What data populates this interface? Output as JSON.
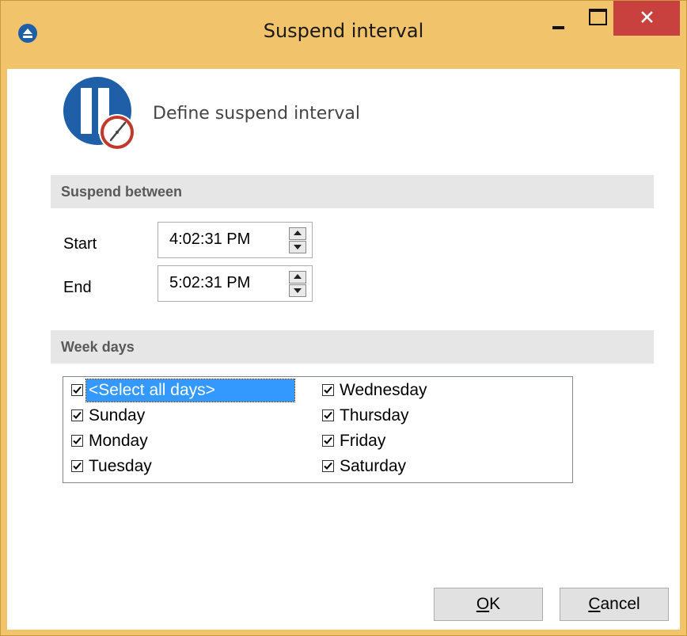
{
  "window": {
    "title": "Suspend interval",
    "icons": {
      "app": "eject-icon",
      "minimize": "minimize-icon",
      "maximize": "maximize-icon",
      "close": "close-icon"
    }
  },
  "header": {
    "icon": "pause-clock-icon",
    "subtitle": "Define suspend interval"
  },
  "suspend_between": {
    "title": "Suspend between",
    "start": {
      "label": "Start",
      "value": "4:02:31 PM"
    },
    "end": {
      "label": "End",
      "value": "5:02:31 PM"
    }
  },
  "week_days": {
    "title": "Week days",
    "items": [
      {
        "label": "<Select all days>",
        "checked": true,
        "selected": true
      },
      {
        "label": "Sunday",
        "checked": true
      },
      {
        "label": "Monday",
        "checked": true
      },
      {
        "label": "Tuesday",
        "checked": true
      },
      {
        "label": "Wednesday",
        "checked": true
      },
      {
        "label": "Thursday",
        "checked": true
      },
      {
        "label": "Friday",
        "checked": true
      },
      {
        "label": "Saturday",
        "checked": true
      }
    ]
  },
  "buttons": {
    "ok": {
      "accel": "O",
      "rest": "K"
    },
    "cancel": {
      "accel": "C",
      "rest": "ancel"
    }
  },
  "colors": {
    "frame": "#f1c36a",
    "close": "#c9413f",
    "brand": "#1f5fa8",
    "selection": "#3399ff"
  }
}
